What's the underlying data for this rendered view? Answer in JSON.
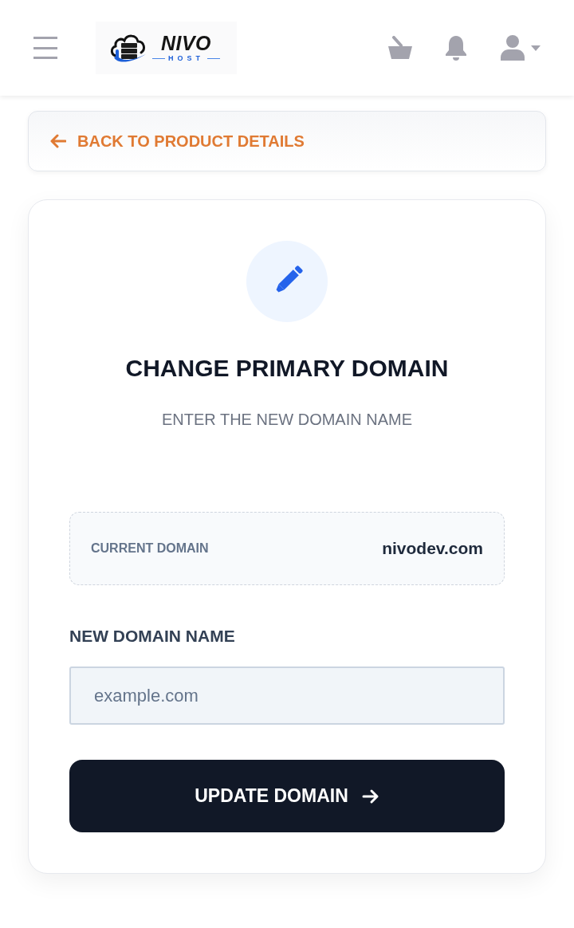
{
  "header": {
    "logo": {
      "wordmark": "NIVO",
      "subtitle": "HOST"
    }
  },
  "back_link": {
    "label": "BACK TO PRODUCT DETAILS"
  },
  "card": {
    "title": "CHANGE PRIMARY DOMAIN",
    "subtitle": "ENTER THE NEW DOMAIN NAME",
    "current_domain": {
      "label": "CURRENT DOMAIN",
      "value": "nivodev.com"
    },
    "new_domain": {
      "label": "NEW DOMAIN NAME",
      "placeholder": "example.com"
    },
    "submit_button": {
      "label": "UPDATE DOMAIN"
    }
  }
}
